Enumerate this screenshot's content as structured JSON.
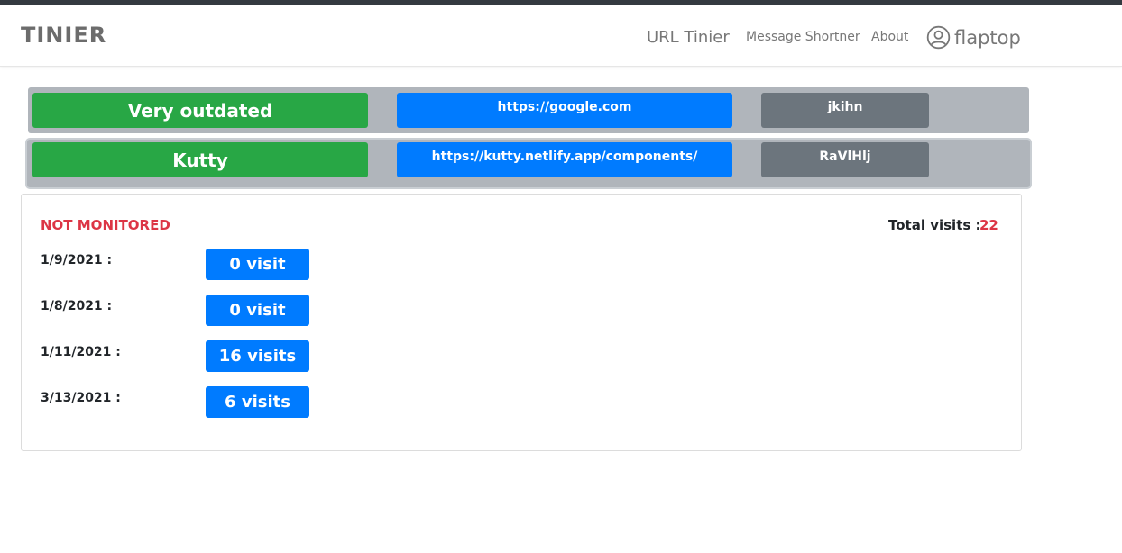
{
  "navbar": {
    "brand": "TINIER",
    "links": [
      {
        "label": "URL Tinier"
      },
      {
        "label": "Message Shortner"
      },
      {
        "label": "About"
      }
    ],
    "user": {
      "name": "flaptop",
      "icon": "user-circle-icon"
    }
  },
  "links": [
    {
      "name": "Very outdated",
      "url": "https://google.com",
      "code": "jkihn"
    },
    {
      "name": "Kutty",
      "url": "https://kutty.netlify.app/components/",
      "code": "RaVlHlj"
    }
  ],
  "details": {
    "status": "NOT MONITORED",
    "total_label": "Total visits :",
    "total_value": "22",
    "visits": [
      {
        "date": "1/9/2021 :",
        "count": "0 visit"
      },
      {
        "date": "1/8/2021 :",
        "count": "0 visit"
      },
      {
        "date": "1/11/2021 :",
        "count": "16 visits"
      },
      {
        "date": "3/13/2021 :",
        "count": "6 visits"
      }
    ]
  },
  "colors": {
    "success": "#28a745",
    "primary": "#007bff",
    "secondary": "#6c757d",
    "danger": "#dc3545",
    "row_bg": "#b0b5bb"
  }
}
